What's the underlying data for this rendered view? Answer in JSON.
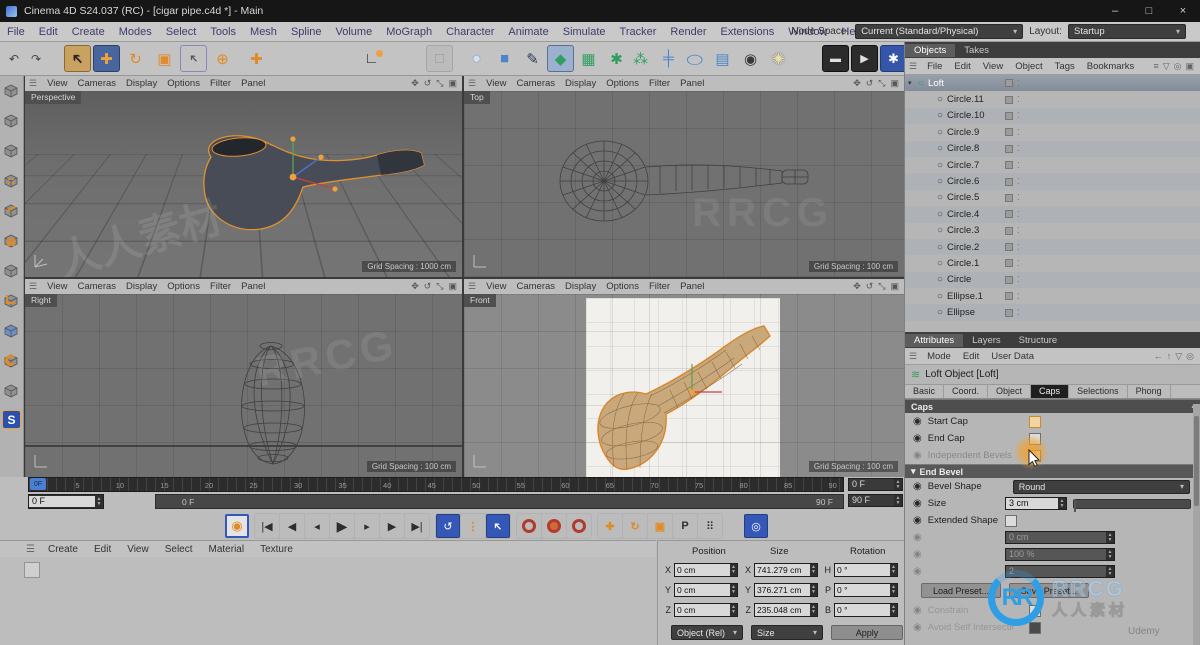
{
  "window": {
    "title": "Cinema 4D S24.037 (RC) - [cigar pipe.c4d *] - Main",
    "minimize": "–",
    "maximize": "□",
    "close": "×"
  },
  "menubar": {
    "items": [
      "File",
      "Edit",
      "Create",
      "Modes",
      "Select",
      "Tools",
      "Mesh",
      "Spline",
      "Volume",
      "MoGraph",
      "Character",
      "Animate",
      "Simulate",
      "Tracker",
      "Render",
      "Extensions",
      "Window",
      "Help"
    ],
    "node_space_label": "Node Space:",
    "node_space_value": "Current (Standard/Physical)",
    "layout_label": "Layout:",
    "layout_value": "Startup"
  },
  "toolbar": {
    "undo": "↶",
    "redo": "↷",
    "live_selection": "➔",
    "move": "✚",
    "rotate": "↻",
    "scale": "▣",
    "selection_drop": "➔",
    "tweak": "⊕",
    "axis": "✚",
    "coord_system": "∟",
    "render_region": "□",
    "sphere": "●",
    "cube": "■",
    "pen": "✎",
    "loft": "◆",
    "volume": "▦",
    "deformer": "✱",
    "fields": "⁂",
    "divider": "╪",
    "ellipse": "◯",
    "mograph": "▤",
    "camera": "◉",
    "light": "✺",
    "render_view": "▬",
    "render_pv": "▶",
    "render_settings": "✱"
  },
  "left_toolbar": {
    "icons": [
      "make-editable",
      "model-mode",
      "texture-mode",
      "workplane-mode",
      "points-mode",
      "edges-mode",
      "polygons-mode",
      "tweak-mode",
      "enable-axis",
      "viewport-solo",
      "snap-ring"
    ],
    "snap_label": "S"
  },
  "viewports": [
    {
      "label": "Perspective",
      "menu": [
        "View",
        "Cameras",
        "Display",
        "Options",
        "Filter",
        "Panel"
      ],
      "grid": "Grid Spacing : 1000 cm"
    },
    {
      "label": "Top",
      "menu": [
        "View",
        "Cameras",
        "Display",
        "Options",
        "Filter",
        "Panel"
      ],
      "grid": "Grid Spacing : 100 cm"
    },
    {
      "label": "Right",
      "menu": [
        "View",
        "Cameras",
        "Display",
        "Options",
        "Filter",
        "Panel"
      ],
      "grid": "Grid Spacing : 100 cm"
    },
    {
      "label": "Front",
      "menu": [
        "View",
        "Cameras",
        "Display",
        "Options",
        "Filter",
        "Panel"
      ],
      "grid": "Grid Spacing : 100 cm"
    }
  ],
  "vp_corner_icons": [
    "✥",
    "↺",
    "⤡",
    "▣"
  ],
  "object_manager": {
    "tabs": [
      "Objects",
      "Takes"
    ],
    "menu": [
      "File",
      "Edit",
      "View",
      "Object",
      "Tags",
      "Bookmarks"
    ],
    "icons": [
      "≡",
      "▽",
      "◎",
      "▣"
    ],
    "objects": [
      {
        "name": "Loft",
        "selected": true
      },
      {
        "name": "Circle.11",
        "child": true
      },
      {
        "name": "Circle.10",
        "child": true
      },
      {
        "name": "Circle.9",
        "child": true
      },
      {
        "name": "Circle.8",
        "child": true
      },
      {
        "name": "Circle.7",
        "child": true
      },
      {
        "name": "Circle.6",
        "child": true
      },
      {
        "name": "Circle.5",
        "child": true
      },
      {
        "name": "Circle.4",
        "child": true
      },
      {
        "name": "Circle.3",
        "child": true
      },
      {
        "name": "Circle.2",
        "child": true
      },
      {
        "name": "Circle.1",
        "child": true
      },
      {
        "name": "Circle",
        "child": true
      },
      {
        "name": "Ellipse.1",
        "child": true
      },
      {
        "name": "Ellipse",
        "child": true
      }
    ]
  },
  "attributes": {
    "tabs": [
      "Attributes",
      "Layers",
      "Structure"
    ],
    "menu": [
      "Mode",
      "Edit",
      "User Data"
    ],
    "icons": [
      "←",
      "↑",
      "▽",
      "◎"
    ],
    "title": "Loft Object [Loft]",
    "prop_tabs": [
      "Basic",
      "Coord.",
      "Object",
      "Caps",
      "Selections",
      "Phong"
    ],
    "active_prop_tab": "Caps",
    "caps_header": "Caps",
    "start_cap": "Start Cap",
    "end_cap": "End Cap",
    "independent": "Independent Bevels",
    "end_bevel_header": "End Bevel",
    "bevel_shape_label": "Bevel Shape",
    "bevel_shape_value": "Round",
    "size_label": "Size",
    "size_value": "3 cm",
    "extended_label": "Extended Shape",
    "dim1_value": "0 cm",
    "dim2_value": "100 %",
    "dim3_value": "2",
    "load_preset": "Load Preset...",
    "save_preset": "Save Preset...",
    "constrain": "Constrain",
    "avoid": "Avoid Self Intersections"
  },
  "timeline": {
    "ticks": [
      "0",
      "5",
      "10",
      "15",
      "20",
      "25",
      "30",
      "35",
      "40",
      "45",
      "50",
      "55",
      "60",
      "65",
      "70",
      "75",
      "80",
      "85",
      "90"
    ],
    "playhead": "0F",
    "frame_field": "0 F",
    "slider_start": "0 F",
    "slider_end": "90 F",
    "range_start": "0 F",
    "range_end": "90 F"
  },
  "playback": {
    "preview": "◉",
    "start": "|◀",
    "prev_key": "◀",
    "prev_frame": "◂",
    "play": "▶",
    "next_frame": "▸",
    "next_key": "▶",
    "end": "▶|",
    "loop": "↺",
    "rate": "⋮",
    "pointer": "➔",
    "kpos": "✚",
    "krot": "↻",
    "kscale": "▣",
    "kparam": "P",
    "kpla": "⠿",
    "solo": "◎"
  },
  "materials": {
    "menu": [
      "Create",
      "Edit",
      "View",
      "Select",
      "Material",
      "Texture"
    ]
  },
  "coordinates": {
    "headers": [
      "Position",
      "Size",
      "Rotation"
    ],
    "labels": {
      "x": "X",
      "y": "Y",
      "z": "Z",
      "h": "H",
      "p": "P",
      "b": "B"
    },
    "pos": {
      "x": "0 cm",
      "y": "0 cm",
      "z": "0 cm"
    },
    "size": {
      "x": "741.279 cm",
      "y": "376.271 cm",
      "z": "235.048 cm"
    },
    "rot": {
      "h": "0 °",
      "p": "0 °",
      "b": "0 °"
    },
    "mode1": "Object (Rel)",
    "mode2": "Size",
    "apply": "Apply"
  },
  "watermarks": {
    "w1": "人人素材",
    "w2": "RRCG",
    "logo_rr": "RR",
    "logo_t1": "RRCG",
    "logo_t2": "人人素材",
    "corner": "Udemy"
  }
}
